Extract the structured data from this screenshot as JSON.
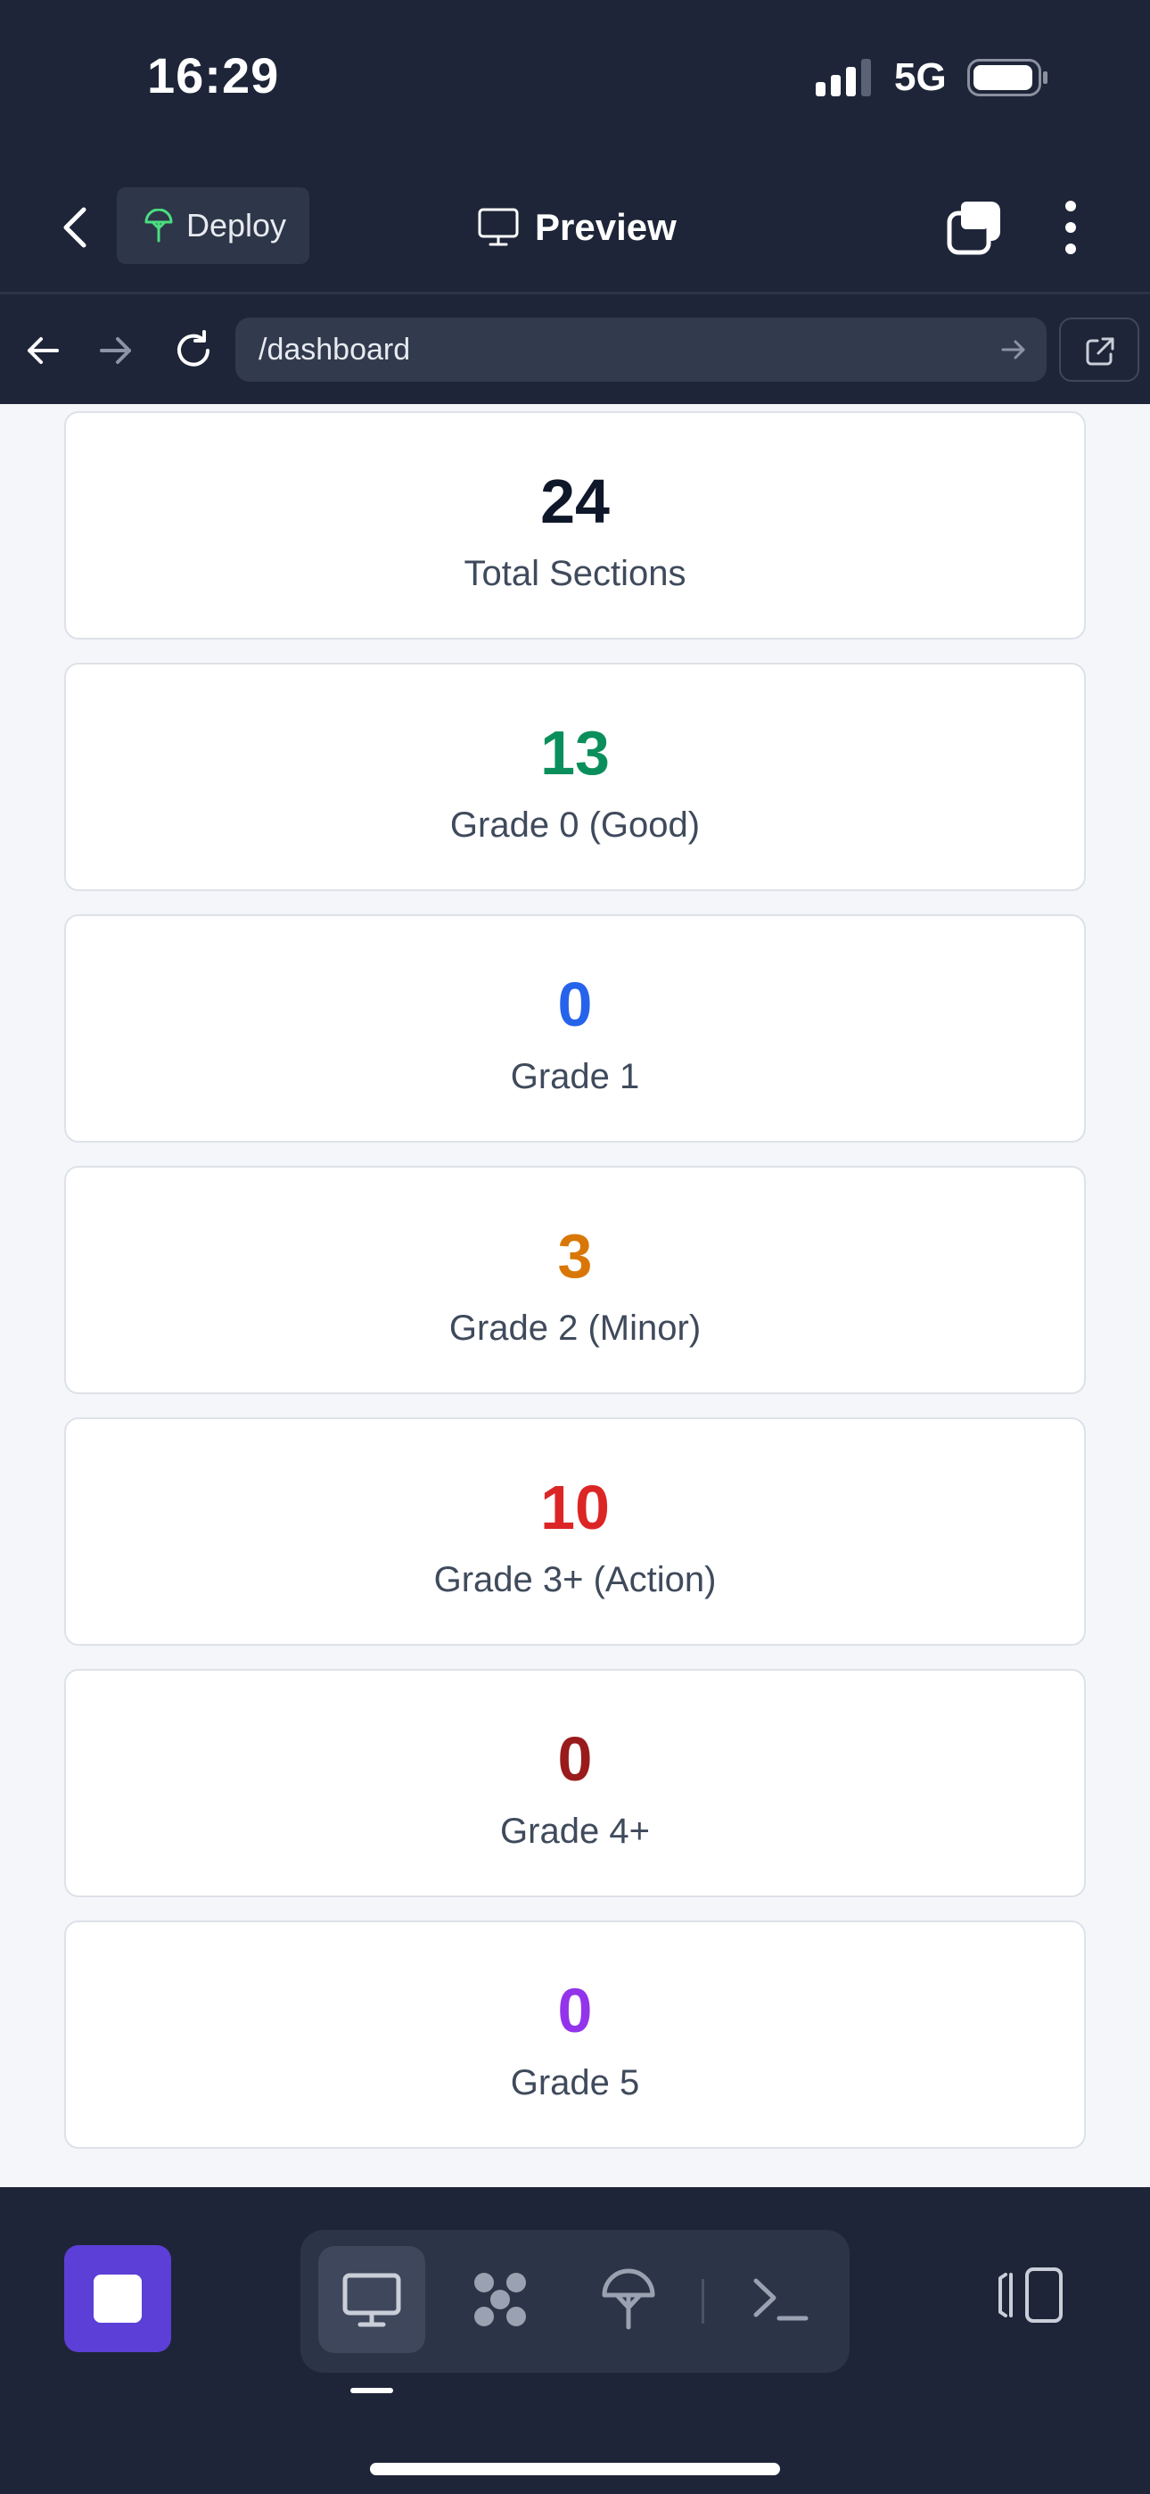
{
  "status_bar": {
    "time": "16:29",
    "network": "5G",
    "icons": [
      "cellular-signal-icon",
      "battery-icon"
    ]
  },
  "app_bar": {
    "back_icon": "chevron-left-icon",
    "deploy": {
      "label": "Deploy",
      "icon": "deploy-icon"
    },
    "title": {
      "label": "Preview",
      "icon": "monitor-icon"
    },
    "tabs_icon": "tabs-icon",
    "more_icon": "more-vertical-icon"
  },
  "url_bar": {
    "back_icon": "arrow-left-icon",
    "forward_icon": "arrow-right-icon",
    "reload_icon": "reload-icon",
    "url": "/dashboard",
    "go_icon": "arrow-right-icon",
    "external_icon": "external-link-icon"
  },
  "stats": [
    {
      "value": "24",
      "label": "Total Sections",
      "color": "#0f172a"
    },
    {
      "value": "13",
      "label": "Grade 0 (Good)",
      "color": "#0a8f5c"
    },
    {
      "value": "0",
      "label": "Grade 1",
      "color": "#2563eb"
    },
    {
      "value": "3",
      "label": "Grade 2 (Minor)",
      "color": "#d97706"
    },
    {
      "value": "10",
      "label": "Grade 3+ (Action)",
      "color": "#dc2626"
    },
    {
      "value": "0",
      "label": "Grade 4+",
      "color": "#991b1b"
    },
    {
      "value": "0",
      "label": "Grade 5",
      "color": "#9333ea"
    }
  ],
  "bottom_bar": {
    "stop_icon": "stop-icon",
    "tools": [
      {
        "name": "preview-tool",
        "icon": "monitor-icon",
        "active": true
      },
      {
        "name": "workflow-tool",
        "icon": "workflow-icon",
        "active": false
      },
      {
        "name": "deploy-tool",
        "icon": "deploy-icon",
        "active": false
      },
      {
        "name": "console-tool",
        "icon": "terminal-icon",
        "active": false
      }
    ],
    "side_panel_icon": "side-panel-icon"
  },
  "colors": {
    "chrome_bg": "#1e2538",
    "accent": "#5b3fd6",
    "content_bg": "#f5f6f9"
  }
}
